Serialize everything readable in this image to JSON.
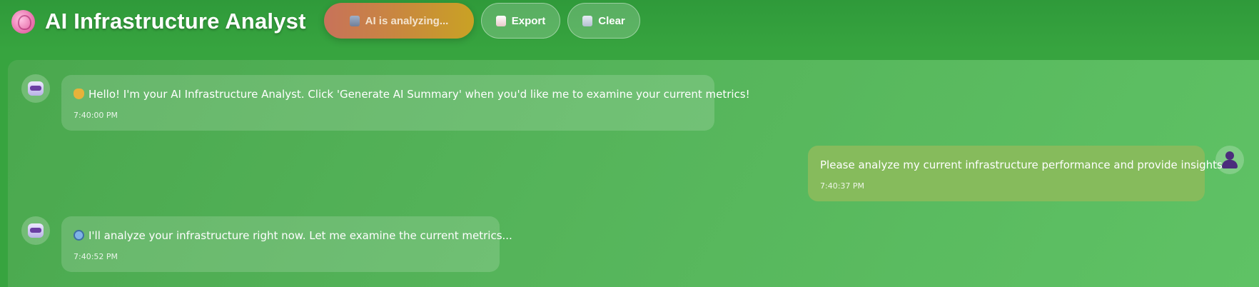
{
  "header": {
    "title": "AI Infrastructure Analyst",
    "title_icon": "brain-icon"
  },
  "toolbar": {
    "analyze_label": "AI is analyzing...",
    "analyze_icon": "robot-icon",
    "export_label": "Export",
    "export_icon": "clipboard-icon",
    "clear_label": "Clear",
    "clear_icon": "trash-icon"
  },
  "messages": [
    {
      "sender": "ai",
      "icon": "robot-icon",
      "emoji": "waving-hand-icon",
      "text": "Hello! I'm your AI Infrastructure Analyst. Click 'Generate AI Summary' when you'd like me to examine your current metrics!",
      "time": "7:40:00 PM"
    },
    {
      "sender": "user",
      "icon": "user-icon",
      "text": "Please analyze my current infrastructure performance and provide insights.",
      "time": "7:40:37 PM"
    },
    {
      "sender": "ai",
      "icon": "robot-icon",
      "emoji": "magnifying-glass-icon",
      "text": "I'll analyze your infrastructure right now. Let me examine the current metrics...",
      "time": "7:40:52 PM"
    }
  ],
  "colors": {
    "header_bg": "#37a43f",
    "panel_bg": "#55b45a",
    "user_bubble": "#86bb5c",
    "analyze_button_start": "#c8725a",
    "analyze_button_end": "#c9a224",
    "avatar_accent": "#6a3fa3"
  }
}
